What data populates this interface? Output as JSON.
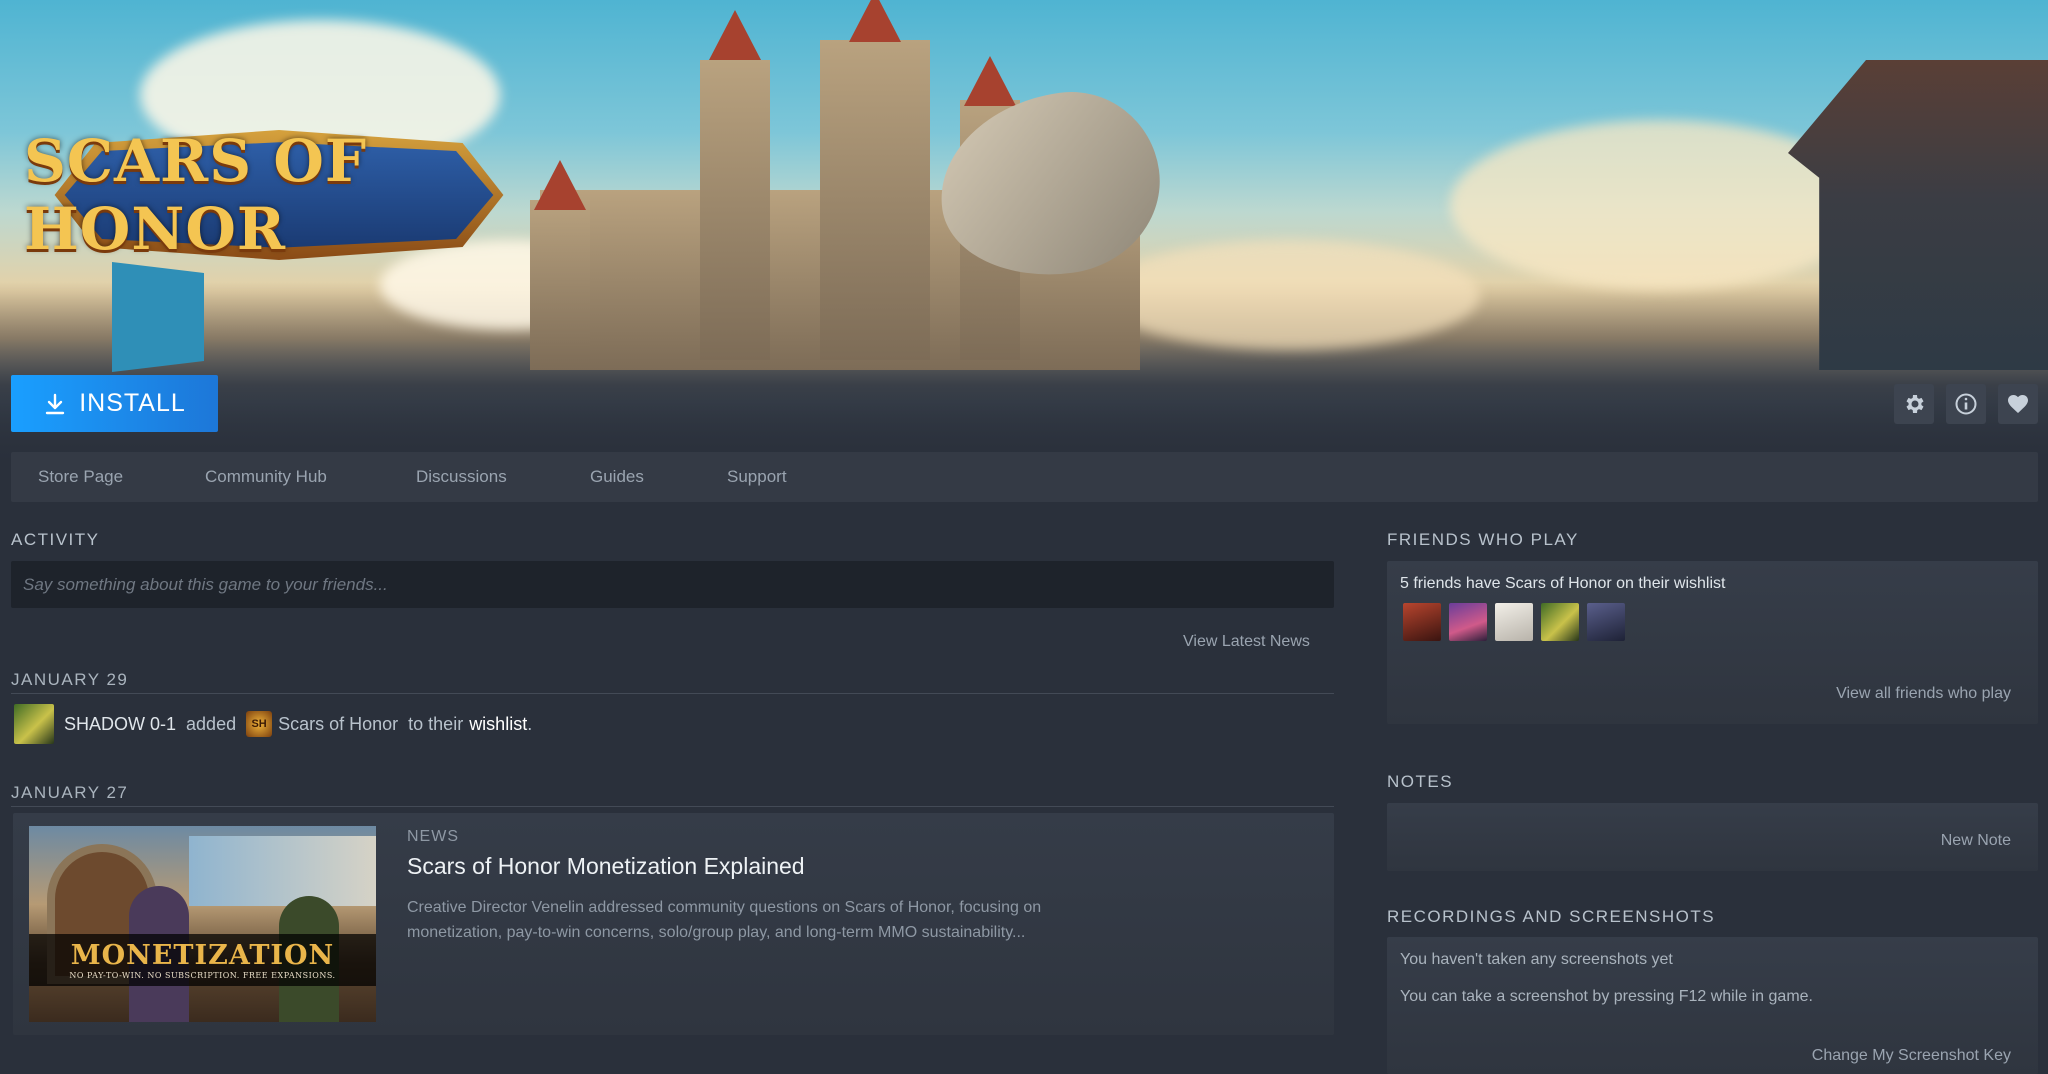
{
  "hero": {
    "logo_text": "SCARS OF HONOR"
  },
  "actions": {
    "install_label": "INSTALL",
    "icons": [
      "download-icon",
      "gear-icon",
      "info-icon",
      "heart-icon"
    ]
  },
  "nav": {
    "items": [
      {
        "label": "Store Page"
      },
      {
        "label": "Community Hub"
      },
      {
        "label": "Discussions"
      },
      {
        "label": "Guides"
      },
      {
        "label": "Support"
      }
    ]
  },
  "activity": {
    "title": "ACTIVITY",
    "input_placeholder": "Say something about this game to your friends...",
    "view_news_label": "View Latest News",
    "entries": [
      {
        "date": "JANUARY 29",
        "user": "SHADOW 0-1",
        "verb": "added",
        "game": "Scars of Honor",
        "suffix": "to their",
        "target": "wishlist",
        "end": "."
      },
      {
        "date": "JANUARY 27",
        "tag": "NEWS",
        "headline": "Scars of Honor Monetization Explained",
        "description": "Creative Director Venelin addressed community questions on Scars of Honor, focusing on monetization, pay-to-win concerns, solo/group play, and long-term MMO sustainability...",
        "thumb_title": "MONETIZATION",
        "thumb_subtitle": "NO PAY-TO-WIN. NO SUBSCRIPTION. FREE EXPANSIONS."
      }
    ]
  },
  "friends": {
    "title": "FRIENDS WHO PLAY",
    "summary": "5 friends have Scars of Honor on their wishlist",
    "avatar_colors": [
      "#7a2a1e",
      "#9b3c5e",
      "#d8d4cc",
      "#4a7a2a",
      "#3a3f5c"
    ],
    "view_all_label": "View all friends who play"
  },
  "notes": {
    "title": "NOTES",
    "new_note_label": "New Note"
  },
  "recordings": {
    "title": "RECORDINGS AND SCREENSHOTS",
    "line1": "You haven't taken any screenshots yet",
    "line2": "You can take a screenshot by pressing F12 while in game.",
    "change_key_label": "Change My Screenshot Key"
  },
  "colors": {
    "accent": "#1a9fff",
    "background": "#2a303b",
    "panel": "#343a45"
  }
}
